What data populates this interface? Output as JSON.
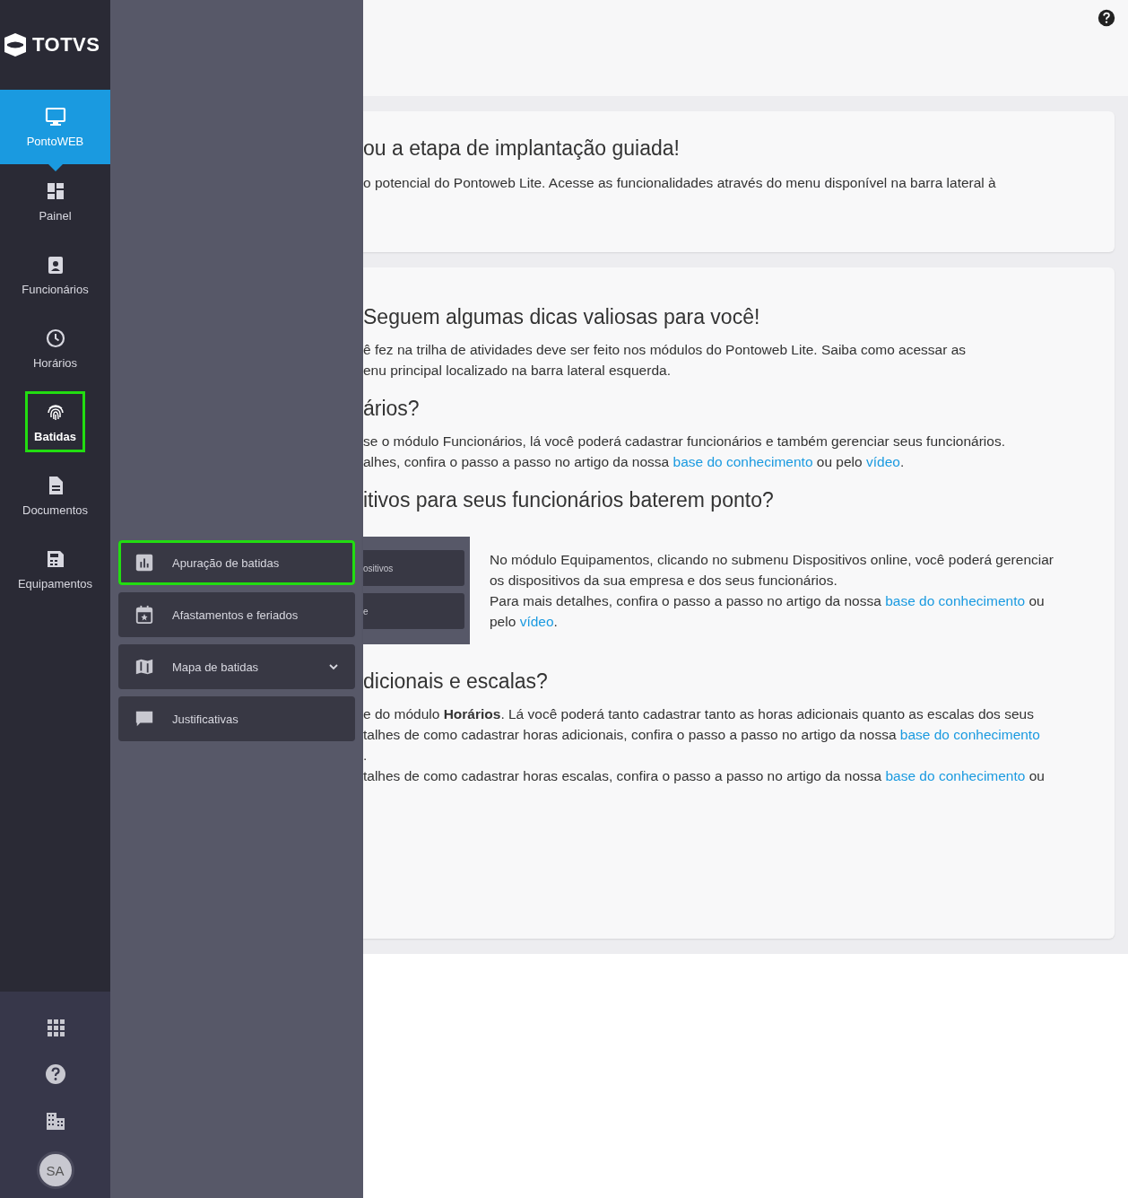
{
  "logo": {
    "text": "TOTVS"
  },
  "nav": [
    {
      "label": "PontoWEB",
      "selected": true,
      "highlighted": false
    },
    {
      "label": "Painel",
      "selected": false,
      "highlighted": false
    },
    {
      "label": "Funcionários",
      "selected": false,
      "highlighted": false
    },
    {
      "label": "Horários",
      "selected": false,
      "highlighted": false
    },
    {
      "label": "Batidas",
      "selected": false,
      "highlighted": true
    },
    {
      "label": "Documentos",
      "selected": false,
      "highlighted": false
    },
    {
      "label": "Equipamentos",
      "selected": false,
      "highlighted": false
    }
  ],
  "bottom_icons": [
    {
      "kind": "apps"
    },
    {
      "kind": "help"
    },
    {
      "kind": "building"
    }
  ],
  "avatar": {
    "initials": "SA"
  },
  "submenu": [
    {
      "label": "Apuração de batidas",
      "highlighted": true,
      "expandable": false
    },
    {
      "label": "Afastamentos e feriados",
      "highlighted": false,
      "expandable": false
    },
    {
      "label": "Mapa de batidas",
      "highlighted": false,
      "expandable": true
    },
    {
      "label": "Justificativas",
      "highlighted": false,
      "expandable": false
    }
  ],
  "cards": [
    {
      "blocks": [
        {
          "kind": "heading",
          "text": "ou a etapa de implantação guiada!"
        },
        {
          "kind": "paragraph",
          "lines": [
            [
              {
                "kind": "text",
                "text": "o potencial do Pontoweb Lite. Acesse as funcionalidades através do menu disponível na barra lateral à"
              }
            ]
          ]
        }
      ]
    },
    {
      "blocks": [
        {
          "kind": "heading",
          "text": "Seguem algumas dicas valiosas para você!"
        },
        {
          "kind": "paragraph",
          "lines": [
            [
              {
                "kind": "text",
                "text": "ê fez na trilha de atividades deve ser feito nos módulos do Pontoweb Lite. Saiba como acessar as"
              }
            ],
            [
              {
                "kind": "text",
                "text": "enu principal localizado na barra lateral esquerda."
              }
            ]
          ]
        },
        {
          "kind": "heading",
          "text": "ários?"
        },
        {
          "kind": "paragraph",
          "lines": [
            [
              {
                "kind": "text",
                "text": "se o módulo Funcionários, lá você poderá cadastrar funcionários e também gerenciar seus funcionários."
              }
            ],
            [
              {
                "kind": "text",
                "text": "alhes, confira o passo a passo no artigo da nossa "
              },
              {
                "kind": "link",
                "text": "base do conhecimento"
              },
              {
                "kind": "text",
                "text": " ou pelo "
              },
              {
                "kind": "link",
                "text": "vídeo"
              },
              {
                "kind": "text",
                "text": "."
              }
            ]
          ]
        },
        {
          "kind": "heading",
          "text": "itivos para seus funcionários baterem ponto?"
        },
        {
          "kind": "media",
          "buttons": [
            "ositivos",
            "e"
          ],
          "lines": [
            [
              {
                "kind": "text",
                "text": "No módulo Equipamentos, clicando no submenu Dispositivos online, você poderá gerenciar"
              }
            ],
            [
              {
                "kind": "text",
                "text": "os dispositivos da sua empresa e dos seus funcionários."
              }
            ],
            [
              {
                "kind": "text",
                "text": "Para mais detalhes, confira o passo a passo no artigo da nossa "
              },
              {
                "kind": "link",
                "text": "base do conhecimento"
              },
              {
                "kind": "text",
                "text": " ou"
              }
            ],
            [
              {
                "kind": "text",
                "text": "pelo "
              },
              {
                "kind": "link",
                "text": "vídeo"
              },
              {
                "kind": "text",
                "text": "."
              }
            ]
          ]
        },
        {
          "kind": "heading",
          "text": "dicionais e escalas?"
        },
        {
          "kind": "paragraph",
          "lines": [
            [
              {
                "kind": "text",
                "text": "e do módulo **Horários**. Lá você poderá tanto cadastrar tanto as horas adicionais quanto as escalas dos seus"
              }
            ],
            [
              {
                "kind": "text",
                "text": "talhes de como cadastrar horas adicionais, confira o passo a passo no artigo da nossa "
              },
              {
                "kind": "link",
                "text": "base do conhecimento"
              }
            ],
            [
              {
                "kind": "text",
                "text": "."
              }
            ],
            [
              {
                "kind": "text",
                "text": "talhes de como cadastrar horas escalas, confira o passo a passo no artigo da nossa "
              },
              {
                "kind": "link",
                "text": "base do conhecimento"
              },
              {
                "kind": "text",
                "text": " ou"
              }
            ]
          ]
        }
      ]
    }
  ]
}
